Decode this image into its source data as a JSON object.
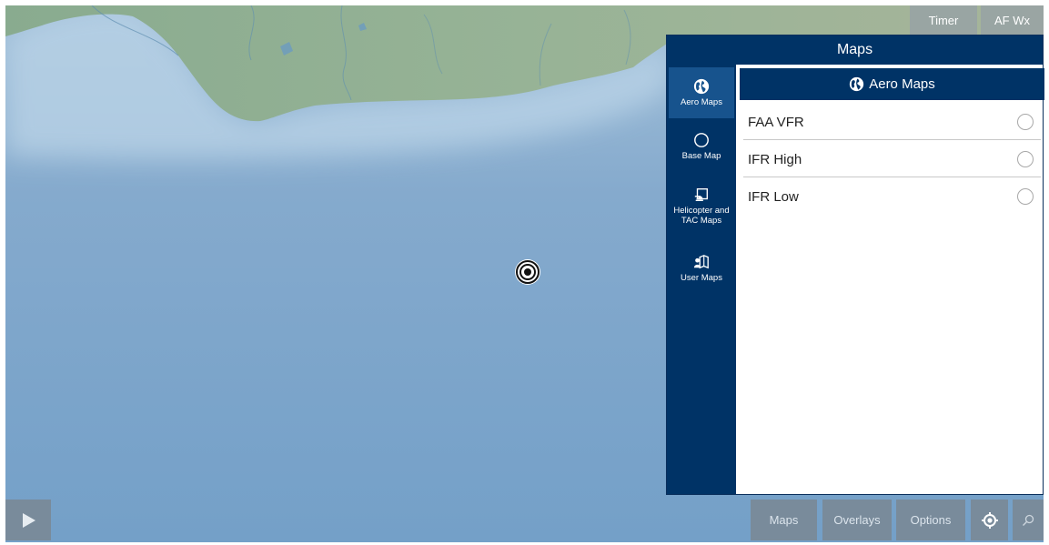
{
  "top_buttons": {
    "timer": "Timer",
    "af_wx": "AF Wx"
  },
  "maps_panel": {
    "title": "Maps",
    "sidebar": [
      {
        "label": "Aero Maps",
        "icon": "globe-icon",
        "active": true
      },
      {
        "label": "Base Map",
        "icon": "circle-icon",
        "active": false
      },
      {
        "label": "Helicopter and TAC Maps",
        "icon": "helicopter-map-icon",
        "active": false
      },
      {
        "label": "User Maps",
        "icon": "user-map-icon",
        "active": false
      }
    ],
    "content_header": "Aero Maps",
    "options": [
      {
        "label": "FAA VFR",
        "selected": false
      },
      {
        "label": "IFR High",
        "selected": false
      },
      {
        "label": "IFR Low",
        "selected": false
      }
    ]
  },
  "bottom_toolbar": {
    "maps": "Maps",
    "overlays": "Overlays",
    "options": "Options"
  },
  "colors": {
    "panel_navy": "#003366",
    "active_tab": "#17538d",
    "ocean": "#7ba2c6",
    "land": "#8eae94"
  }
}
